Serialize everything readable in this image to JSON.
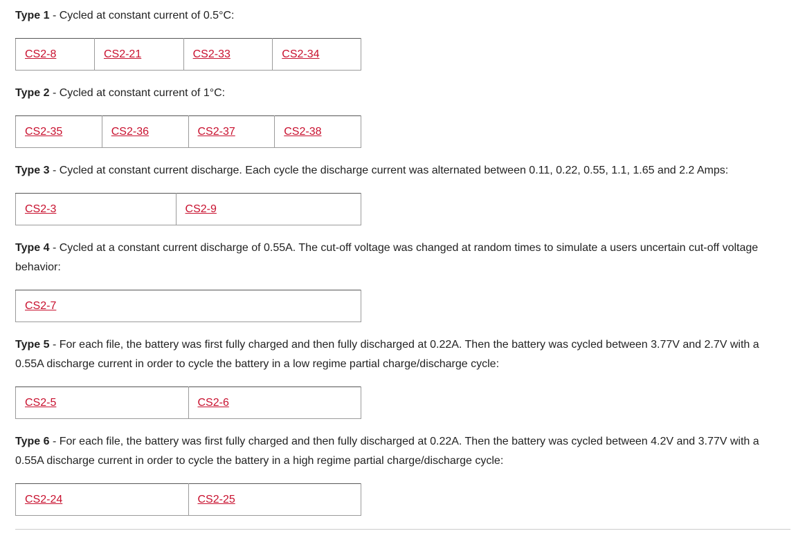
{
  "types": [
    {
      "label": "Type 1",
      "description": " - Cycled at constant current of 0.5°C:",
      "files": [
        "CS2-8",
        "CS2-21",
        "CS2-33",
        "CS2-34"
      ]
    },
    {
      "label": "Type 2",
      "description": " - Cycled at constant current of 1°C:",
      "files": [
        "CS2-35",
        "CS2-36",
        "CS2-37",
        "CS2-38"
      ]
    },
    {
      "label": "Type 3",
      "description": " - Cycled at constant current discharge. Each cycle the discharge current was alternated between 0.11, 0.22, 0.55, 1.1, 1.65 and 2.2 Amps:",
      "files": [
        "CS2-3",
        "CS2-9"
      ]
    },
    {
      "label": "Type 4",
      "description": " - Cycled at a constant current discharge of 0.55A. The cut-off voltage was changed at random times to simulate a users uncertain cut-off voltage behavior:",
      "files": [
        "CS2-7"
      ]
    },
    {
      "label": "Type 5",
      "description": " - For each file, the battery was first fully charged and then fully discharged at 0.22A. Then the battery was cycled between 3.77V and 2.7V with a 0.55A discharge current in order to cycle the battery in a low regime partial charge/discharge cycle:",
      "files": [
        "CS2-5",
        "CS2-6"
      ]
    },
    {
      "label": "Type 6",
      "description": " - For each file, the battery was first fully charged and then fully discharged at 0.22A. Then the battery was cycled between 4.2V and 3.77V with a 0.55A discharge current in order to cycle the battery in a high regime partial charge/discharge cycle:",
      "files": [
        "CS2-24",
        "CS2-25"
      ]
    }
  ],
  "colors": {
    "link": "#c8102e",
    "text": "#222222",
    "border": "#9a9a9a"
  }
}
